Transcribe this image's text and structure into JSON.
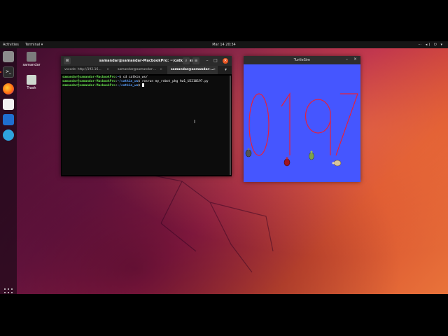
{
  "topbar": {
    "activities": "Activities",
    "app_menu": "Terminal ▾",
    "clock": "Mar 14  20:34",
    "status_icons": "⋯ ◂) ⏻ ▾"
  },
  "desktop": {
    "icons": [
      {
        "label": "samandar",
        "icon": "home-folder-icon"
      },
      {
        "label": "Trash",
        "icon": "trash-icon"
      }
    ]
  },
  "dock": {
    "apps": [
      "files-icon",
      "terminal-icon",
      "firefox-icon",
      "text-editor-icon",
      "vscode-icon",
      "telegram-icon"
    ],
    "show_apps": "show-applications-icon"
  },
  "terminal": {
    "title": "samandar@samandar-MacbookPro: ~/catkin_ws",
    "tabs": [
      {
        "label": "vscode: http://192.16..."
      },
      {
        "label": "samandar@samandar-..."
      },
      {
        "label": "samandar@samandar-..."
      }
    ],
    "lines": [
      {
        "prompt": "samandar@samandar-MacbookPro",
        "path": "~",
        "command": "cd catkin_ws/"
      },
      {
        "prompt": "samandar@samandar-MacbookPro",
        "path": "~/catkin_ws",
        "command": "rosrun my_robot_pkg hw1_U2210197.py"
      },
      {
        "prompt": "samandar@samandar-MacbookPro",
        "path": "~/catkin_ws",
        "command": ""
      }
    ]
  },
  "turtlesim": {
    "title": "TurtleSim",
    "drawn_text": "0197",
    "background_color": "#4556ff",
    "pen_color": "#e8203a",
    "turtle_count": 4
  },
  "colors": {
    "ubuntu_orange": "#e95420",
    "prompt_green": "#66e04c",
    "prompt_blue": "#5aa0ff"
  }
}
